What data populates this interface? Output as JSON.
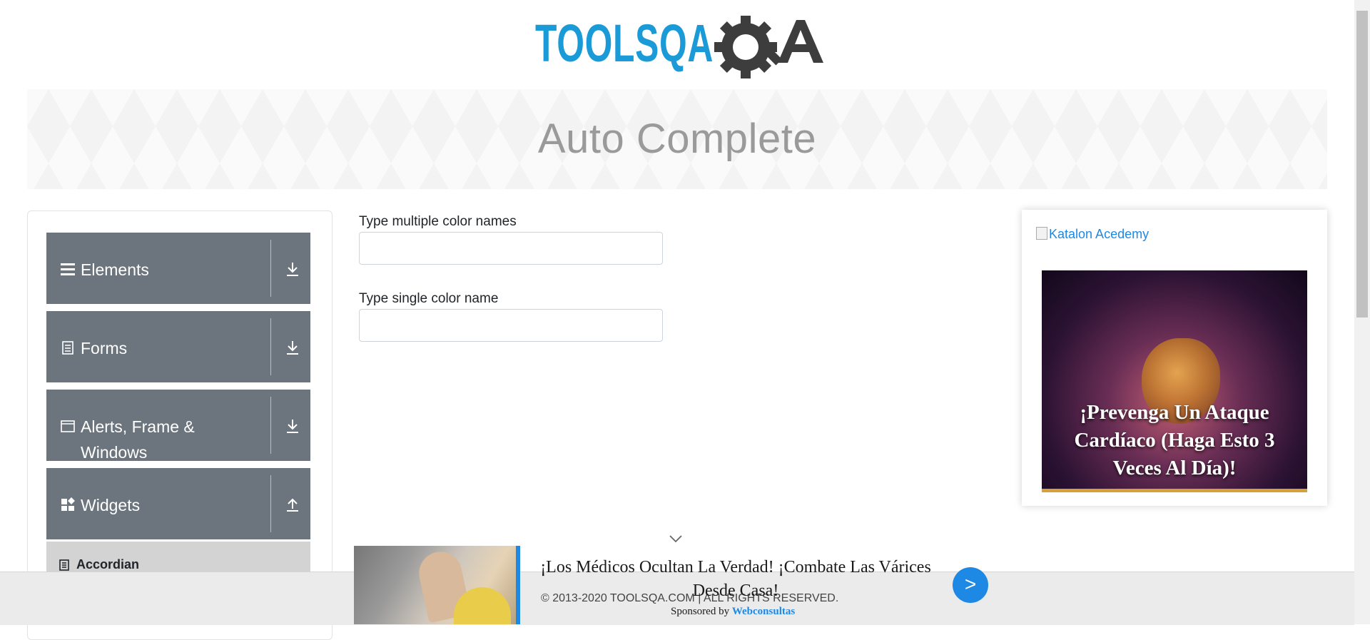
{
  "header": {
    "logo_text": "TOOLSQA"
  },
  "page_title": "Auto Complete",
  "sidebar": {
    "groups": [
      {
        "label": "Elements",
        "icon": "hamburger-icon",
        "state": "collapsed"
      },
      {
        "label": "Forms",
        "icon": "document-icon",
        "state": "collapsed"
      },
      {
        "label": "Alerts, Frame & Windows",
        "icon": "window-icon",
        "state": "collapsed"
      },
      {
        "label": "Widgets",
        "icon": "widgets-icon",
        "state": "expanded"
      }
    ],
    "sub_items": [
      {
        "label": "Accordian",
        "icon": "list-icon"
      }
    ]
  },
  "form": {
    "multi_label": "Type multiple color names",
    "multi_value": "",
    "single_label": "Type single color name",
    "single_value": ""
  },
  "right_ad": {
    "broken_image_alt": "Katalon Acedemy",
    "ad_text": "¡Prevenga Un Ataque Cardíaco (Haga Esto 3 Veces Al Día)!"
  },
  "bottom_ad": {
    "headline": "¡Los Médicos Ocultan La Verdad! ¡Combate Las Várices Desde Casa!",
    "sponsored_by": "Sponsored by",
    "sponsor": "Webconsultas",
    "button_label": ">"
  },
  "footer": {
    "copyright": "© 2013-2020 TOOLSQA.COM | ALL RIGHTS RESERVED."
  },
  "colors": {
    "logo_blue": "#1a9ad6",
    "logo_gray": "#3d3d3d",
    "sidebar_group": "#6c757d",
    "ad_accent": "#1e88e5"
  }
}
